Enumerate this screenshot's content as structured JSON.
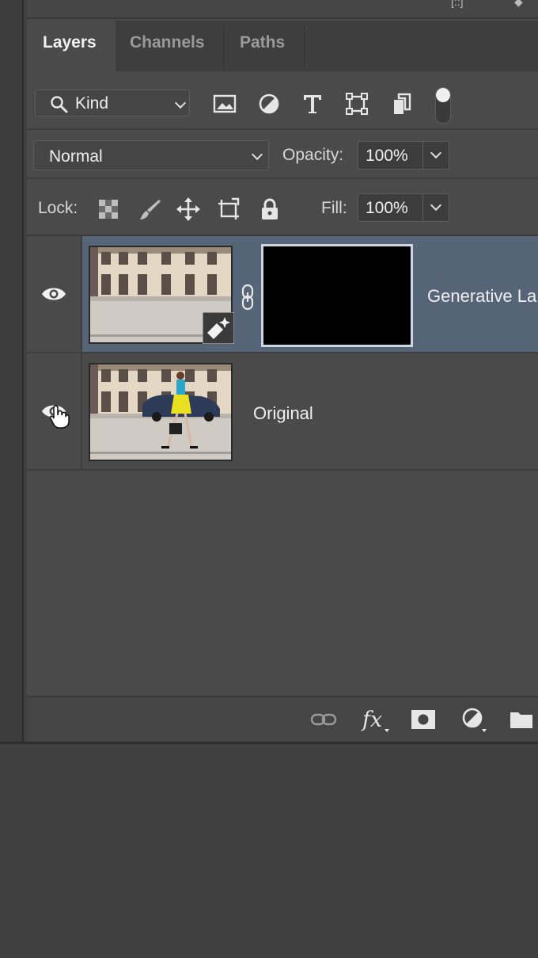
{
  "panel": {
    "tabs": [
      {
        "label": "Layers",
        "active": true
      },
      {
        "label": "Channels",
        "active": false
      },
      {
        "label": "Paths",
        "active": false
      }
    ],
    "filter": {
      "kind_label": "Kind",
      "filter_icons": [
        "image-filter-icon",
        "adjustment-filter-icon",
        "type-filter-icon",
        "shape-filter-icon",
        "smart-object-filter-icon"
      ]
    },
    "blend": {
      "mode": "Normal",
      "opacity_label": "Opacity:",
      "opacity_value": "100%"
    },
    "lock": {
      "label": "Lock:",
      "fill_label": "Fill:",
      "fill_value": "100%"
    },
    "layers": [
      {
        "name": "Generative La",
        "selected": true,
        "visible": true,
        "has_mask": true
      },
      {
        "name": "Original",
        "selected": false,
        "visible": true,
        "has_mask": false
      }
    ]
  },
  "colors": {
    "panel_bg": "#4a4a4a",
    "selected_row": "#566478",
    "tab_bar": "#3e3e3e",
    "text": "#f0f0f0"
  }
}
